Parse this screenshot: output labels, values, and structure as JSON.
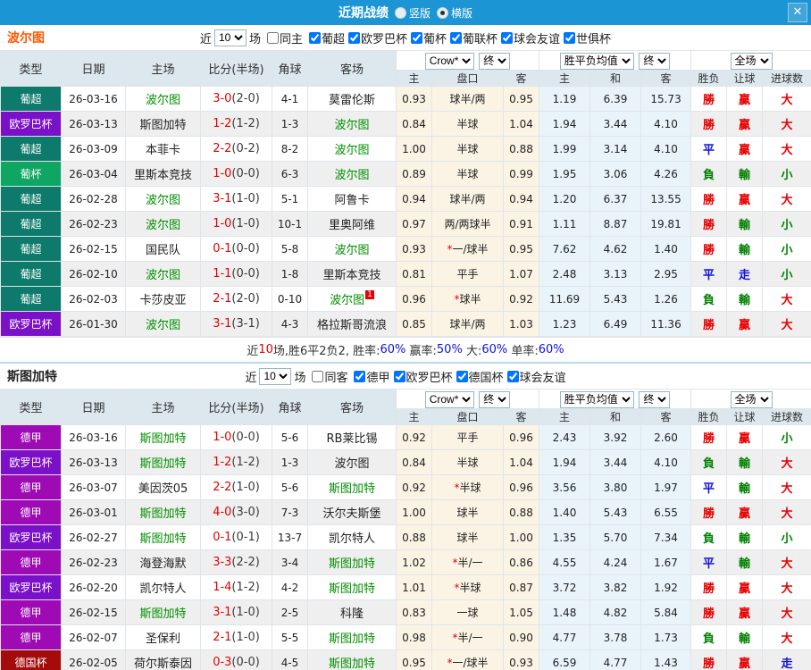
{
  "accent": {
    "titlebar_bg": "#1b95d3",
    "team_highlight": "#008f00",
    "score_red": "#e60000",
    "stat_blue": "#1010dd"
  },
  "titlebar": {
    "title": "近期战绩",
    "close": "✕",
    "radios": [
      {
        "label": "竖版",
        "selected": false
      },
      {
        "label": "横版",
        "selected": true
      }
    ]
  },
  "columns": {
    "type": "类型",
    "date": "日期",
    "home": "主场",
    "score": "比分(半场)",
    "corner": "角球",
    "away": "客场",
    "odds_home": "主",
    "handicap": "盘口",
    "odds_away": "客",
    "avg_home": "主",
    "avg_draw": "和",
    "avg_away": "客",
    "result": "胜负",
    "handicap_result": "让球",
    "goals": "进球数",
    "selects": {
      "company": "Crow*",
      "final": "终",
      "avg": "胜平负均值",
      "scope": "全场"
    }
  },
  "league_colors": {
    "葡超": "#0d7a6b",
    "欧罗巴杯": "#7b10c9",
    "葡杯": "#0fa562",
    "德甲": "#9e0ab4",
    "德国杯": "#a40c0c"
  },
  "result_colors": {
    "勝": "#e60000",
    "平": "#1010dd",
    "負": "#008000",
    "贏": "#e60000",
    "輸": "#008000",
    "走": "#1010dd",
    "大": "#e60000",
    "小": "#008000"
  },
  "sections": [
    {
      "team": "波尔图",
      "team_color": "#ff5a00",
      "filter": {
        "near": "近",
        "count": "10",
        "games": "场",
        "same": "同主",
        "same_checked": false,
        "leagues": [
          {
            "label": "葡超",
            "checked": true
          },
          {
            "label": "欧罗巴杯",
            "checked": true
          },
          {
            "label": "葡杯",
            "checked": true
          },
          {
            "label": "葡联杯",
            "checked": true
          },
          {
            "label": "球会友谊",
            "checked": true
          },
          {
            "label": "世俱杯",
            "checked": true
          }
        ]
      },
      "rows": [
        {
          "league": "葡超",
          "date": "26-03-16",
          "home": "波尔图",
          "home_hl": true,
          "ft": "3-0",
          "ht": "(2-0)",
          "corner": "4-1",
          "away": "莫雷伦斯",
          "away_hl": false,
          "h_odds": "0.93",
          "handicap": "球半/两",
          "a_odds": "0.95",
          "avg_h": "1.19",
          "avg_d": "6.39",
          "avg_a": "15.73",
          "res_wdl": "勝",
          "res_hc": "贏",
          "res_goal": "大"
        },
        {
          "league": "欧罗巴杯",
          "date": "26-03-13",
          "home": "斯图加特",
          "home_hl": false,
          "ft": "1-2",
          "ht": "(1-2)",
          "corner": "1-3",
          "away": "波尔图",
          "away_hl": true,
          "h_odds": "0.84",
          "handicap": "半球",
          "a_odds": "1.04",
          "avg_h": "1.94",
          "avg_d": "3.44",
          "avg_a": "4.10",
          "res_wdl": "勝",
          "res_hc": "贏",
          "res_goal": "大"
        },
        {
          "league": "葡超",
          "date": "26-03-09",
          "home": "本菲卡",
          "home_hl": false,
          "ft": "2-2",
          "ht": "(0-2)",
          "corner": "8-2",
          "away": "波尔图",
          "away_hl": true,
          "h_odds": "1.00",
          "handicap": "半球",
          "a_odds": "0.88",
          "avg_h": "1.99",
          "avg_d": "3.14",
          "avg_a": "4.10",
          "res_wdl": "平",
          "res_hc": "贏",
          "res_goal": "大"
        },
        {
          "league": "葡杯",
          "date": "26-03-04",
          "home": "里斯本竞技",
          "home_hl": false,
          "ft": "1-0",
          "ht": "(0-0)",
          "corner": "6-3",
          "away": "波尔图",
          "away_hl": true,
          "h_odds": "0.89",
          "handicap": "半球",
          "a_odds": "0.99",
          "avg_h": "1.95",
          "avg_d": "3.06",
          "avg_a": "4.26",
          "res_wdl": "負",
          "res_hc": "輸",
          "res_goal": "小"
        },
        {
          "league": "葡超",
          "date": "26-02-28",
          "home": "波尔图",
          "home_hl": true,
          "ft": "3-1",
          "ht": "(1-0)",
          "corner": "5-1",
          "away": "阿鲁卡",
          "away_hl": false,
          "h_odds": "0.94",
          "handicap": "球半/两",
          "a_odds": "0.94",
          "avg_h": "1.20",
          "avg_d": "6.37",
          "avg_a": "13.55",
          "res_wdl": "勝",
          "res_hc": "贏",
          "res_goal": "大"
        },
        {
          "league": "葡超",
          "date": "26-02-23",
          "home": "波尔图",
          "home_hl": true,
          "ft": "1-0",
          "ht": "(1-0)",
          "corner": "10-1",
          "away": "里奥阿维",
          "away_hl": false,
          "h_odds": "0.97",
          "handicap": "两/两球半",
          "a_odds": "0.91",
          "avg_h": "1.11",
          "avg_d": "8.87",
          "avg_a": "19.81",
          "res_wdl": "勝",
          "res_hc": "輸",
          "res_goal": "小"
        },
        {
          "league": "葡超",
          "date": "26-02-15",
          "home": "国民队",
          "home_hl": false,
          "ft": "0-1",
          "ht": "(0-0)",
          "corner": "5-8",
          "away": "波尔图",
          "away_hl": true,
          "h_odds": "0.93",
          "handicap": "*一/球半",
          "a_odds": "0.95",
          "avg_h": "7.62",
          "avg_d": "4.62",
          "avg_a": "1.40",
          "res_wdl": "勝",
          "res_hc": "輸",
          "res_goal": "小"
        },
        {
          "league": "葡超",
          "date": "26-02-10",
          "home": "波尔图",
          "home_hl": true,
          "ft": "1-1",
          "ht": "(0-0)",
          "corner": "1-8",
          "away": "里斯本竞技",
          "away_hl": false,
          "h_odds": "0.81",
          "handicap": "平手",
          "a_odds": "1.07",
          "avg_h": "2.48",
          "avg_d": "3.13",
          "avg_a": "2.95",
          "res_wdl": "平",
          "res_hc": "走",
          "res_goal": "小"
        },
        {
          "league": "葡超",
          "date": "26-02-03",
          "home": "卡莎皮亚",
          "home_hl": false,
          "ft": "2-1",
          "ht": "(2-0)",
          "corner": "0-10",
          "away": "波尔图",
          "away_hl": true,
          "away_card": "1",
          "h_odds": "0.96",
          "handicap": "*球半",
          "a_odds": "0.92",
          "avg_h": "11.69",
          "avg_d": "5.43",
          "avg_a": "1.26",
          "res_wdl": "負",
          "res_hc": "輸",
          "res_goal": "大"
        },
        {
          "league": "欧罗巴杯",
          "date": "26-01-30",
          "home": "波尔图",
          "home_hl": true,
          "ft": "3-1",
          "ht": "(3-1)",
          "corner": "4-3",
          "away": "格拉斯哥流浪",
          "away_hl": false,
          "h_odds": "0.85",
          "handicap": "球半/两",
          "a_odds": "1.03",
          "avg_h": "1.23",
          "avg_d": "6.49",
          "avg_a": "11.36",
          "res_wdl": "勝",
          "res_hc": "贏",
          "res_goal": "大"
        }
      ],
      "summary": [
        {
          "t": "近",
          "c": "#333333"
        },
        {
          "t": "10",
          "c": "#e60000"
        },
        {
          "t": "场,胜6平2负2, 胜率:",
          "c": "#333333"
        },
        {
          "t": "60%",
          "c": "#1010dd"
        },
        {
          "t": " 赢率:",
          "c": "#333333"
        },
        {
          "t": "50%",
          "c": "#1010dd"
        },
        {
          "t": " 大:",
          "c": "#333333"
        },
        {
          "t": "60%",
          "c": "#1010dd"
        },
        {
          "t": " 单率:",
          "c": "#333333"
        },
        {
          "t": "60%",
          "c": "#1010dd"
        }
      ]
    },
    {
      "team": "斯图加特",
      "team_color": "#222222",
      "filter": {
        "near": "近",
        "count": "10",
        "games": "场",
        "same": "同客",
        "same_checked": false,
        "leagues": [
          {
            "label": "德甲",
            "checked": true
          },
          {
            "label": "欧罗巴杯",
            "checked": true
          },
          {
            "label": "德国杯",
            "checked": true
          },
          {
            "label": "球会友谊",
            "checked": true
          }
        ]
      },
      "rows": [
        {
          "league": "德甲",
          "date": "26-03-16",
          "home": "斯图加特",
          "home_hl": true,
          "ft": "1-0",
          "ht": "(0-0)",
          "corner": "5-6",
          "away": "RB莱比锡",
          "away_hl": false,
          "h_odds": "0.92",
          "handicap": "平手",
          "a_odds": "0.96",
          "avg_h": "2.43",
          "avg_d": "3.92",
          "avg_a": "2.60",
          "res_wdl": "勝",
          "res_hc": "贏",
          "res_goal": "小"
        },
        {
          "league": "欧罗巴杯",
          "date": "26-03-13",
          "home": "斯图加特",
          "home_hl": true,
          "ft": "1-2",
          "ht": "(1-2)",
          "corner": "1-3",
          "away": "波尔图",
          "away_hl": false,
          "h_odds": "0.84",
          "handicap": "半球",
          "a_odds": "1.04",
          "avg_h": "1.94",
          "avg_d": "3.44",
          "avg_a": "4.10",
          "res_wdl": "負",
          "res_hc": "輸",
          "res_goal": "大"
        },
        {
          "league": "德甲",
          "date": "26-03-07",
          "home": "美因茨05",
          "home_hl": false,
          "ft": "2-2",
          "ht": "(1-0)",
          "corner": "5-6",
          "away": "斯图加特",
          "away_hl": true,
          "h_odds": "0.92",
          "handicap": "*半球",
          "a_odds": "0.96",
          "avg_h": "3.56",
          "avg_d": "3.80",
          "avg_a": "1.97",
          "res_wdl": "平",
          "res_hc": "輸",
          "res_goal": "大"
        },
        {
          "league": "德甲",
          "date": "26-03-01",
          "home": "斯图加特",
          "home_hl": true,
          "ft": "4-0",
          "ht": "(3-0)",
          "corner": "7-3",
          "away": "沃尔夫斯堡",
          "away_hl": false,
          "h_odds": "1.00",
          "handicap": "球半",
          "a_odds": "0.88",
          "avg_h": "1.40",
          "avg_d": "5.43",
          "avg_a": "6.55",
          "res_wdl": "勝",
          "res_hc": "贏",
          "res_goal": "大"
        },
        {
          "league": "欧罗巴杯",
          "date": "26-02-27",
          "home": "斯图加特",
          "home_hl": true,
          "ft": "0-1",
          "ht": "(0-1)",
          "corner": "13-7",
          "away": "凯尔特人",
          "away_hl": false,
          "h_odds": "0.88",
          "handicap": "球半",
          "a_odds": "1.00",
          "avg_h": "1.35",
          "avg_d": "5.70",
          "avg_a": "7.34",
          "res_wdl": "負",
          "res_hc": "輸",
          "res_goal": "小"
        },
        {
          "league": "德甲",
          "date": "26-02-23",
          "home": "海登海默",
          "home_hl": false,
          "ft": "3-3",
          "ht": "(2-2)",
          "corner": "3-4",
          "away": "斯图加特",
          "away_hl": true,
          "h_odds": "1.02",
          "handicap": "*半/一",
          "a_odds": "0.86",
          "avg_h": "4.55",
          "avg_d": "4.24",
          "avg_a": "1.67",
          "res_wdl": "平",
          "res_hc": "輸",
          "res_goal": "大"
        },
        {
          "league": "欧罗巴杯",
          "date": "26-02-20",
          "home": "凯尔特人",
          "home_hl": false,
          "ft": "1-4",
          "ht": "(1-2)",
          "corner": "4-2",
          "away": "斯图加特",
          "away_hl": true,
          "h_odds": "1.01",
          "handicap": "*半球",
          "a_odds": "0.87",
          "avg_h": "3.72",
          "avg_d": "3.82",
          "avg_a": "1.92",
          "res_wdl": "勝",
          "res_hc": "贏",
          "res_goal": "大"
        },
        {
          "league": "德甲",
          "date": "26-02-15",
          "home": "斯图加特",
          "home_hl": true,
          "ft": "3-1",
          "ht": "(1-0)",
          "corner": "2-5",
          "away": "科隆",
          "away_hl": false,
          "h_odds": "0.83",
          "handicap": "一球",
          "a_odds": "1.05",
          "avg_h": "1.48",
          "avg_d": "4.82",
          "avg_a": "5.84",
          "res_wdl": "勝",
          "res_hc": "贏",
          "res_goal": "大"
        },
        {
          "league": "德甲",
          "date": "26-02-07",
          "home": "圣保利",
          "home_hl": false,
          "ft": "2-1",
          "ht": "(1-0)",
          "corner": "5-5",
          "away": "斯图加特",
          "away_hl": true,
          "h_odds": "0.98",
          "handicap": "*半/一",
          "a_odds": "0.90",
          "avg_h": "4.77",
          "avg_d": "3.78",
          "avg_a": "1.73",
          "res_wdl": "負",
          "res_hc": "輸",
          "res_goal": "大"
        },
        {
          "league": "德国杯",
          "date": "26-02-05",
          "home": "荷尔斯泰因",
          "home_hl": false,
          "ft": "0-3",
          "ht": "(0-0)",
          "corner": "4-5",
          "away": "斯图加特",
          "away_hl": true,
          "h_odds": "0.95",
          "handicap": "*一/球半",
          "a_odds": "0.93",
          "avg_h": "6.59",
          "avg_d": "4.77",
          "avg_a": "1.43",
          "res_wdl": "勝",
          "res_hc": "贏",
          "res_goal": "走"
        }
      ]
    }
  ]
}
